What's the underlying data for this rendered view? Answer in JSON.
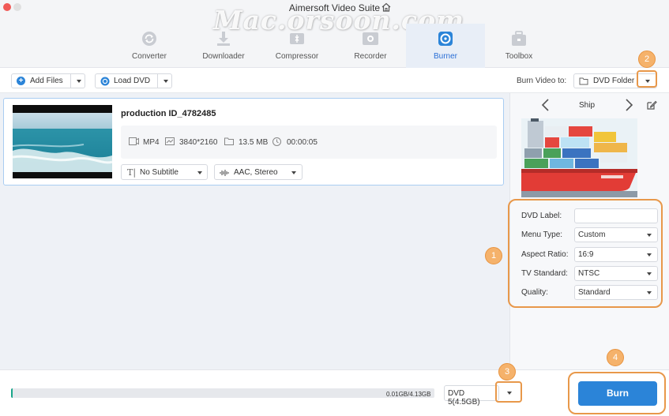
{
  "window": {
    "title": "Aimersoft Video Suite",
    "watermark": "Mac.orsoon.com"
  },
  "modules": [
    {
      "label": "Converter",
      "icon": "converter-icon",
      "active": false
    },
    {
      "label": "Downloader",
      "icon": "downloader-icon",
      "active": false
    },
    {
      "label": "Compressor",
      "icon": "compressor-icon",
      "active": false
    },
    {
      "label": "Recorder",
      "icon": "recorder-icon",
      "active": false
    },
    {
      "label": "Burner",
      "icon": "burner-icon",
      "active": true
    },
    {
      "label": "Toolbox",
      "icon": "toolbox-icon",
      "active": false
    }
  ],
  "toolbar": {
    "add_files": "Add Files",
    "load_dvd": "Load DVD",
    "burn_to_label": "Burn Video to:",
    "burn_to_value": "DVD Folder"
  },
  "file": {
    "name": "production ID_4782485",
    "format": "MP4",
    "resolution": "3840*2160",
    "size": "13.5 MB",
    "duration": "00:00:05",
    "subtitle": "No Subtitle",
    "audio": "AAC, Stereo"
  },
  "template": {
    "name": "Ship"
  },
  "settings": {
    "dvd_label": {
      "label": "DVD Label:",
      "value": ""
    },
    "menu_type": {
      "label": "Menu Type:",
      "value": "Custom"
    },
    "aspect_ratio": {
      "label": "Aspect Ratio:",
      "value": "16:9"
    },
    "tv_standard": {
      "label": "TV Standard:",
      "value": "NTSC"
    },
    "quality": {
      "label": "Quality:",
      "value": "Standard"
    }
  },
  "bottom": {
    "capacity_text": "0.01GB/4.13GB",
    "capacity_fraction": 0.0024,
    "disc_type": "DVD 5(4.5GB)",
    "burn_label": "Burn"
  },
  "annotations": [
    "1",
    "2",
    "3",
    "4"
  ],
  "colors": {
    "accent": "#2b84d8",
    "annotation": "#e8984a",
    "progress": "#1aa68a"
  }
}
